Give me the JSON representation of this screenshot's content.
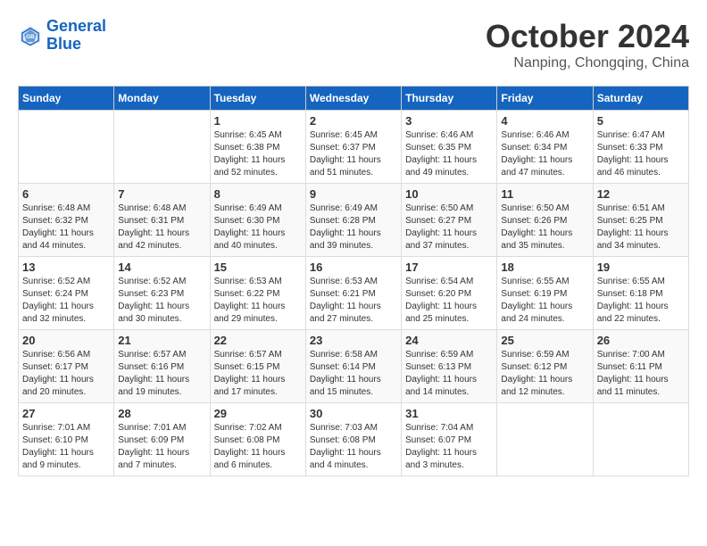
{
  "header": {
    "logo_line1": "General",
    "logo_line2": "Blue",
    "month": "October 2024",
    "location": "Nanping, Chongqing, China"
  },
  "weekdays": [
    "Sunday",
    "Monday",
    "Tuesday",
    "Wednesday",
    "Thursday",
    "Friday",
    "Saturday"
  ],
  "weeks": [
    [
      {
        "day": "",
        "info": ""
      },
      {
        "day": "",
        "info": ""
      },
      {
        "day": "1",
        "info": "Sunrise: 6:45 AM\nSunset: 6:38 PM\nDaylight: 11 hours and 52 minutes."
      },
      {
        "day": "2",
        "info": "Sunrise: 6:45 AM\nSunset: 6:37 PM\nDaylight: 11 hours and 51 minutes."
      },
      {
        "day": "3",
        "info": "Sunrise: 6:46 AM\nSunset: 6:35 PM\nDaylight: 11 hours and 49 minutes."
      },
      {
        "day": "4",
        "info": "Sunrise: 6:46 AM\nSunset: 6:34 PM\nDaylight: 11 hours and 47 minutes."
      },
      {
        "day": "5",
        "info": "Sunrise: 6:47 AM\nSunset: 6:33 PM\nDaylight: 11 hours and 46 minutes."
      }
    ],
    [
      {
        "day": "6",
        "info": "Sunrise: 6:48 AM\nSunset: 6:32 PM\nDaylight: 11 hours and 44 minutes."
      },
      {
        "day": "7",
        "info": "Sunrise: 6:48 AM\nSunset: 6:31 PM\nDaylight: 11 hours and 42 minutes."
      },
      {
        "day": "8",
        "info": "Sunrise: 6:49 AM\nSunset: 6:30 PM\nDaylight: 11 hours and 40 minutes."
      },
      {
        "day": "9",
        "info": "Sunrise: 6:49 AM\nSunset: 6:28 PM\nDaylight: 11 hours and 39 minutes."
      },
      {
        "day": "10",
        "info": "Sunrise: 6:50 AM\nSunset: 6:27 PM\nDaylight: 11 hours and 37 minutes."
      },
      {
        "day": "11",
        "info": "Sunrise: 6:50 AM\nSunset: 6:26 PM\nDaylight: 11 hours and 35 minutes."
      },
      {
        "day": "12",
        "info": "Sunrise: 6:51 AM\nSunset: 6:25 PM\nDaylight: 11 hours and 34 minutes."
      }
    ],
    [
      {
        "day": "13",
        "info": "Sunrise: 6:52 AM\nSunset: 6:24 PM\nDaylight: 11 hours and 32 minutes."
      },
      {
        "day": "14",
        "info": "Sunrise: 6:52 AM\nSunset: 6:23 PM\nDaylight: 11 hours and 30 minutes."
      },
      {
        "day": "15",
        "info": "Sunrise: 6:53 AM\nSunset: 6:22 PM\nDaylight: 11 hours and 29 minutes."
      },
      {
        "day": "16",
        "info": "Sunrise: 6:53 AM\nSunset: 6:21 PM\nDaylight: 11 hours and 27 minutes."
      },
      {
        "day": "17",
        "info": "Sunrise: 6:54 AM\nSunset: 6:20 PM\nDaylight: 11 hours and 25 minutes."
      },
      {
        "day": "18",
        "info": "Sunrise: 6:55 AM\nSunset: 6:19 PM\nDaylight: 11 hours and 24 minutes."
      },
      {
        "day": "19",
        "info": "Sunrise: 6:55 AM\nSunset: 6:18 PM\nDaylight: 11 hours and 22 minutes."
      }
    ],
    [
      {
        "day": "20",
        "info": "Sunrise: 6:56 AM\nSunset: 6:17 PM\nDaylight: 11 hours and 20 minutes."
      },
      {
        "day": "21",
        "info": "Sunrise: 6:57 AM\nSunset: 6:16 PM\nDaylight: 11 hours and 19 minutes."
      },
      {
        "day": "22",
        "info": "Sunrise: 6:57 AM\nSunset: 6:15 PM\nDaylight: 11 hours and 17 minutes."
      },
      {
        "day": "23",
        "info": "Sunrise: 6:58 AM\nSunset: 6:14 PM\nDaylight: 11 hours and 15 minutes."
      },
      {
        "day": "24",
        "info": "Sunrise: 6:59 AM\nSunset: 6:13 PM\nDaylight: 11 hours and 14 minutes."
      },
      {
        "day": "25",
        "info": "Sunrise: 6:59 AM\nSunset: 6:12 PM\nDaylight: 11 hours and 12 minutes."
      },
      {
        "day": "26",
        "info": "Sunrise: 7:00 AM\nSunset: 6:11 PM\nDaylight: 11 hours and 11 minutes."
      }
    ],
    [
      {
        "day": "27",
        "info": "Sunrise: 7:01 AM\nSunset: 6:10 PM\nDaylight: 11 hours and 9 minutes."
      },
      {
        "day": "28",
        "info": "Sunrise: 7:01 AM\nSunset: 6:09 PM\nDaylight: 11 hours and 7 minutes."
      },
      {
        "day": "29",
        "info": "Sunrise: 7:02 AM\nSunset: 6:08 PM\nDaylight: 11 hours and 6 minutes."
      },
      {
        "day": "30",
        "info": "Sunrise: 7:03 AM\nSunset: 6:08 PM\nDaylight: 11 hours and 4 minutes."
      },
      {
        "day": "31",
        "info": "Sunrise: 7:04 AM\nSunset: 6:07 PM\nDaylight: 11 hours and 3 minutes."
      },
      {
        "day": "",
        "info": ""
      },
      {
        "day": "",
        "info": ""
      }
    ]
  ]
}
